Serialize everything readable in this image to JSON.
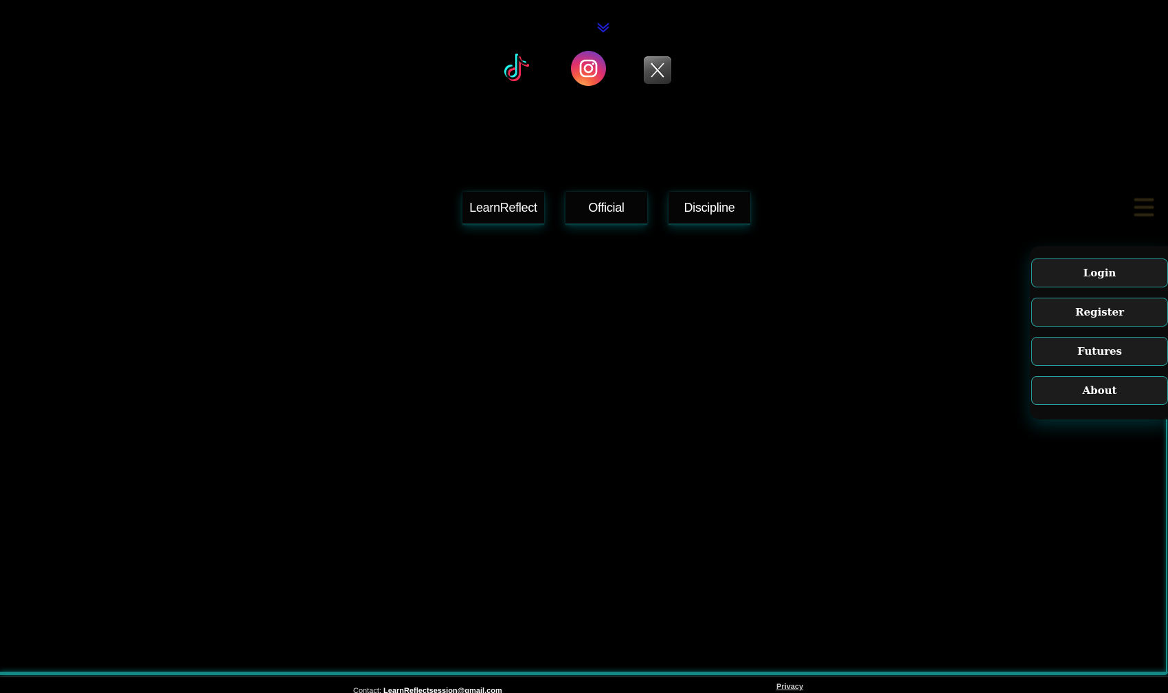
{
  "social": {
    "items": [
      {
        "name": "TikTok",
        "icon": "tiktok-icon"
      },
      {
        "name": "Instagram",
        "icon": "instagram-icon"
      },
      {
        "name": "X",
        "icon": "x-icon"
      }
    ]
  },
  "tags": {
    "items": [
      "LearnReflect",
      "Official",
      "Discipline"
    ]
  },
  "menu": {
    "items": [
      "Login",
      "Register",
      "Futures",
      "About"
    ]
  },
  "footer": {
    "contact_label": "Contact:",
    "contact_email": "LearnReflectsession@gmail.com",
    "privacy_label": "Privacy"
  },
  "colors": {
    "background": "#000000",
    "accent_teal": "#27a7a4",
    "chevron_blue": "#1a1acc"
  }
}
